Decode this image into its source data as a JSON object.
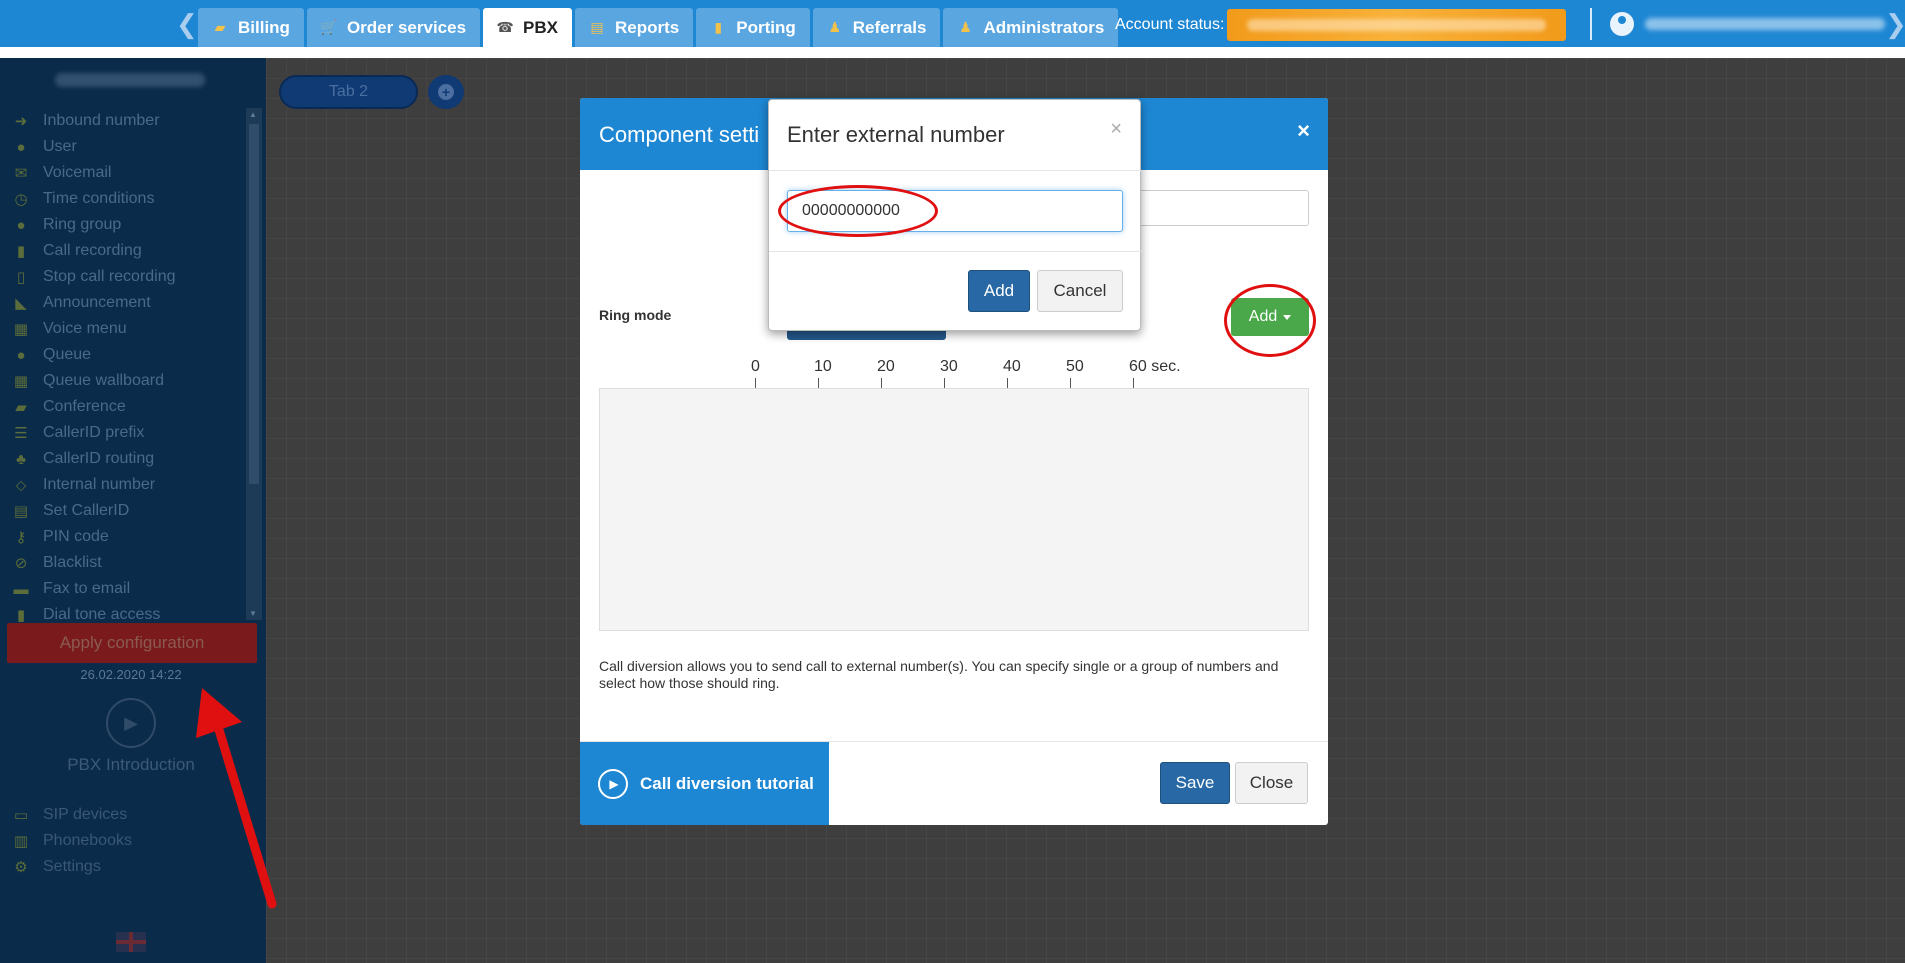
{
  "topnav": {
    "prev_arrow": "❮",
    "next_arrow": "❯",
    "tabs": [
      {
        "label": "Billing",
        "icon": "coins-icon",
        "glyph": "▰",
        "active": false
      },
      {
        "label": "Order services",
        "icon": "cart-icon",
        "glyph": "🛒",
        "active": false
      },
      {
        "label": "PBX",
        "icon": "pbx-icon",
        "glyph": "☎",
        "active": true
      },
      {
        "label": "Reports",
        "icon": "reports-icon",
        "glyph": "▤",
        "active": false
      },
      {
        "label": "Porting",
        "icon": "phone-icon",
        "glyph": "▮",
        "active": false
      },
      {
        "label": "Referrals",
        "icon": "referral-icon",
        "glyph": "♟",
        "active": false
      },
      {
        "label": "Administrators",
        "icon": "admin-icon",
        "glyph": "♟",
        "active": false
      }
    ],
    "account_status_label": "Account status:"
  },
  "sidebar": {
    "items": [
      {
        "label": "Inbound number",
        "icon": "arrow-right-icon",
        "glyph": "➜"
      },
      {
        "label": "User",
        "icon": "user-icon",
        "glyph": "●"
      },
      {
        "label": "Voicemail",
        "icon": "envelope-icon",
        "glyph": "✉"
      },
      {
        "label": "Time conditions",
        "icon": "clock-icon",
        "glyph": "◷"
      },
      {
        "label": "Ring group",
        "icon": "group-icon",
        "glyph": "●"
      },
      {
        "label": "Call recording",
        "icon": "microphone-icon",
        "glyph": "▮"
      },
      {
        "label": "Stop call recording",
        "icon": "mic-off-icon",
        "glyph": "▯"
      },
      {
        "label": "Announcement",
        "icon": "megaphone-icon",
        "glyph": "◣"
      },
      {
        "label": "Voice menu",
        "icon": "grid-icon",
        "glyph": "▦"
      },
      {
        "label": "Queue",
        "icon": "user-plus-icon",
        "glyph": "●"
      },
      {
        "label": "Queue wallboard",
        "icon": "table-icon",
        "glyph": "▦"
      },
      {
        "label": "Conference",
        "icon": "comments-icon",
        "glyph": "▰"
      },
      {
        "label": "CallerID prefix",
        "icon": "list-icon",
        "glyph": "☰"
      },
      {
        "label": "CallerID routing",
        "icon": "sitemap-icon",
        "glyph": "♣"
      },
      {
        "label": "Internal number",
        "icon": "pin-icon",
        "glyph": "⬦"
      },
      {
        "label": "Set CallerID",
        "icon": "id-card-icon",
        "glyph": "▤"
      },
      {
        "label": "PIN code",
        "icon": "key-icon",
        "glyph": "⚷"
      },
      {
        "label": "Blacklist",
        "icon": "ban-icon",
        "glyph": "⊘"
      },
      {
        "label": "Fax to email",
        "icon": "fax-icon",
        "glyph": "▬"
      },
      {
        "label": "Dial tone access",
        "icon": "lock-icon",
        "glyph": "▮"
      }
    ],
    "apply_label": "Apply configuration",
    "apply_date": "26.02.2020 14:22",
    "intro_label": "PBX Introduction",
    "bottom_items": [
      {
        "label": "SIP devices",
        "icon": "monitor-icon",
        "glyph": "▭"
      },
      {
        "label": "Phonebooks",
        "icon": "book-icon",
        "glyph": "▥"
      },
      {
        "label": "Settings",
        "icon": "gear-icon",
        "glyph": "⚙"
      }
    ]
  },
  "canvas": {
    "tab_label": "Tab 2",
    "add_tab_glyph": "+"
  },
  "component_modal": {
    "title": "Component setti",
    "close_glyph": "×",
    "ring_mode_label": "Ring mode",
    "add_label": "Add",
    "timeline_ticks": [
      "0",
      "10",
      "20",
      "30",
      "40",
      "50",
      "60 sec."
    ],
    "description": "Call diversion allows you to send call to external number(s). You can specify single or a group of numbers and select how those should ring.",
    "tutorial_label": "Call diversion tutorial",
    "save_label": "Save",
    "close_label": "Close"
  },
  "external_dialog": {
    "title": "Enter external number",
    "close_glyph": "×",
    "input_value": "00000000000",
    "add_label": "Add",
    "cancel_label": "Cancel"
  },
  "colors": {
    "brand_blue": "#1e87d4",
    "primary_button": "#2768a5",
    "success_green": "#4aa84a",
    "annotation_red": "#e01010",
    "account_orange": "#f29a1a"
  }
}
